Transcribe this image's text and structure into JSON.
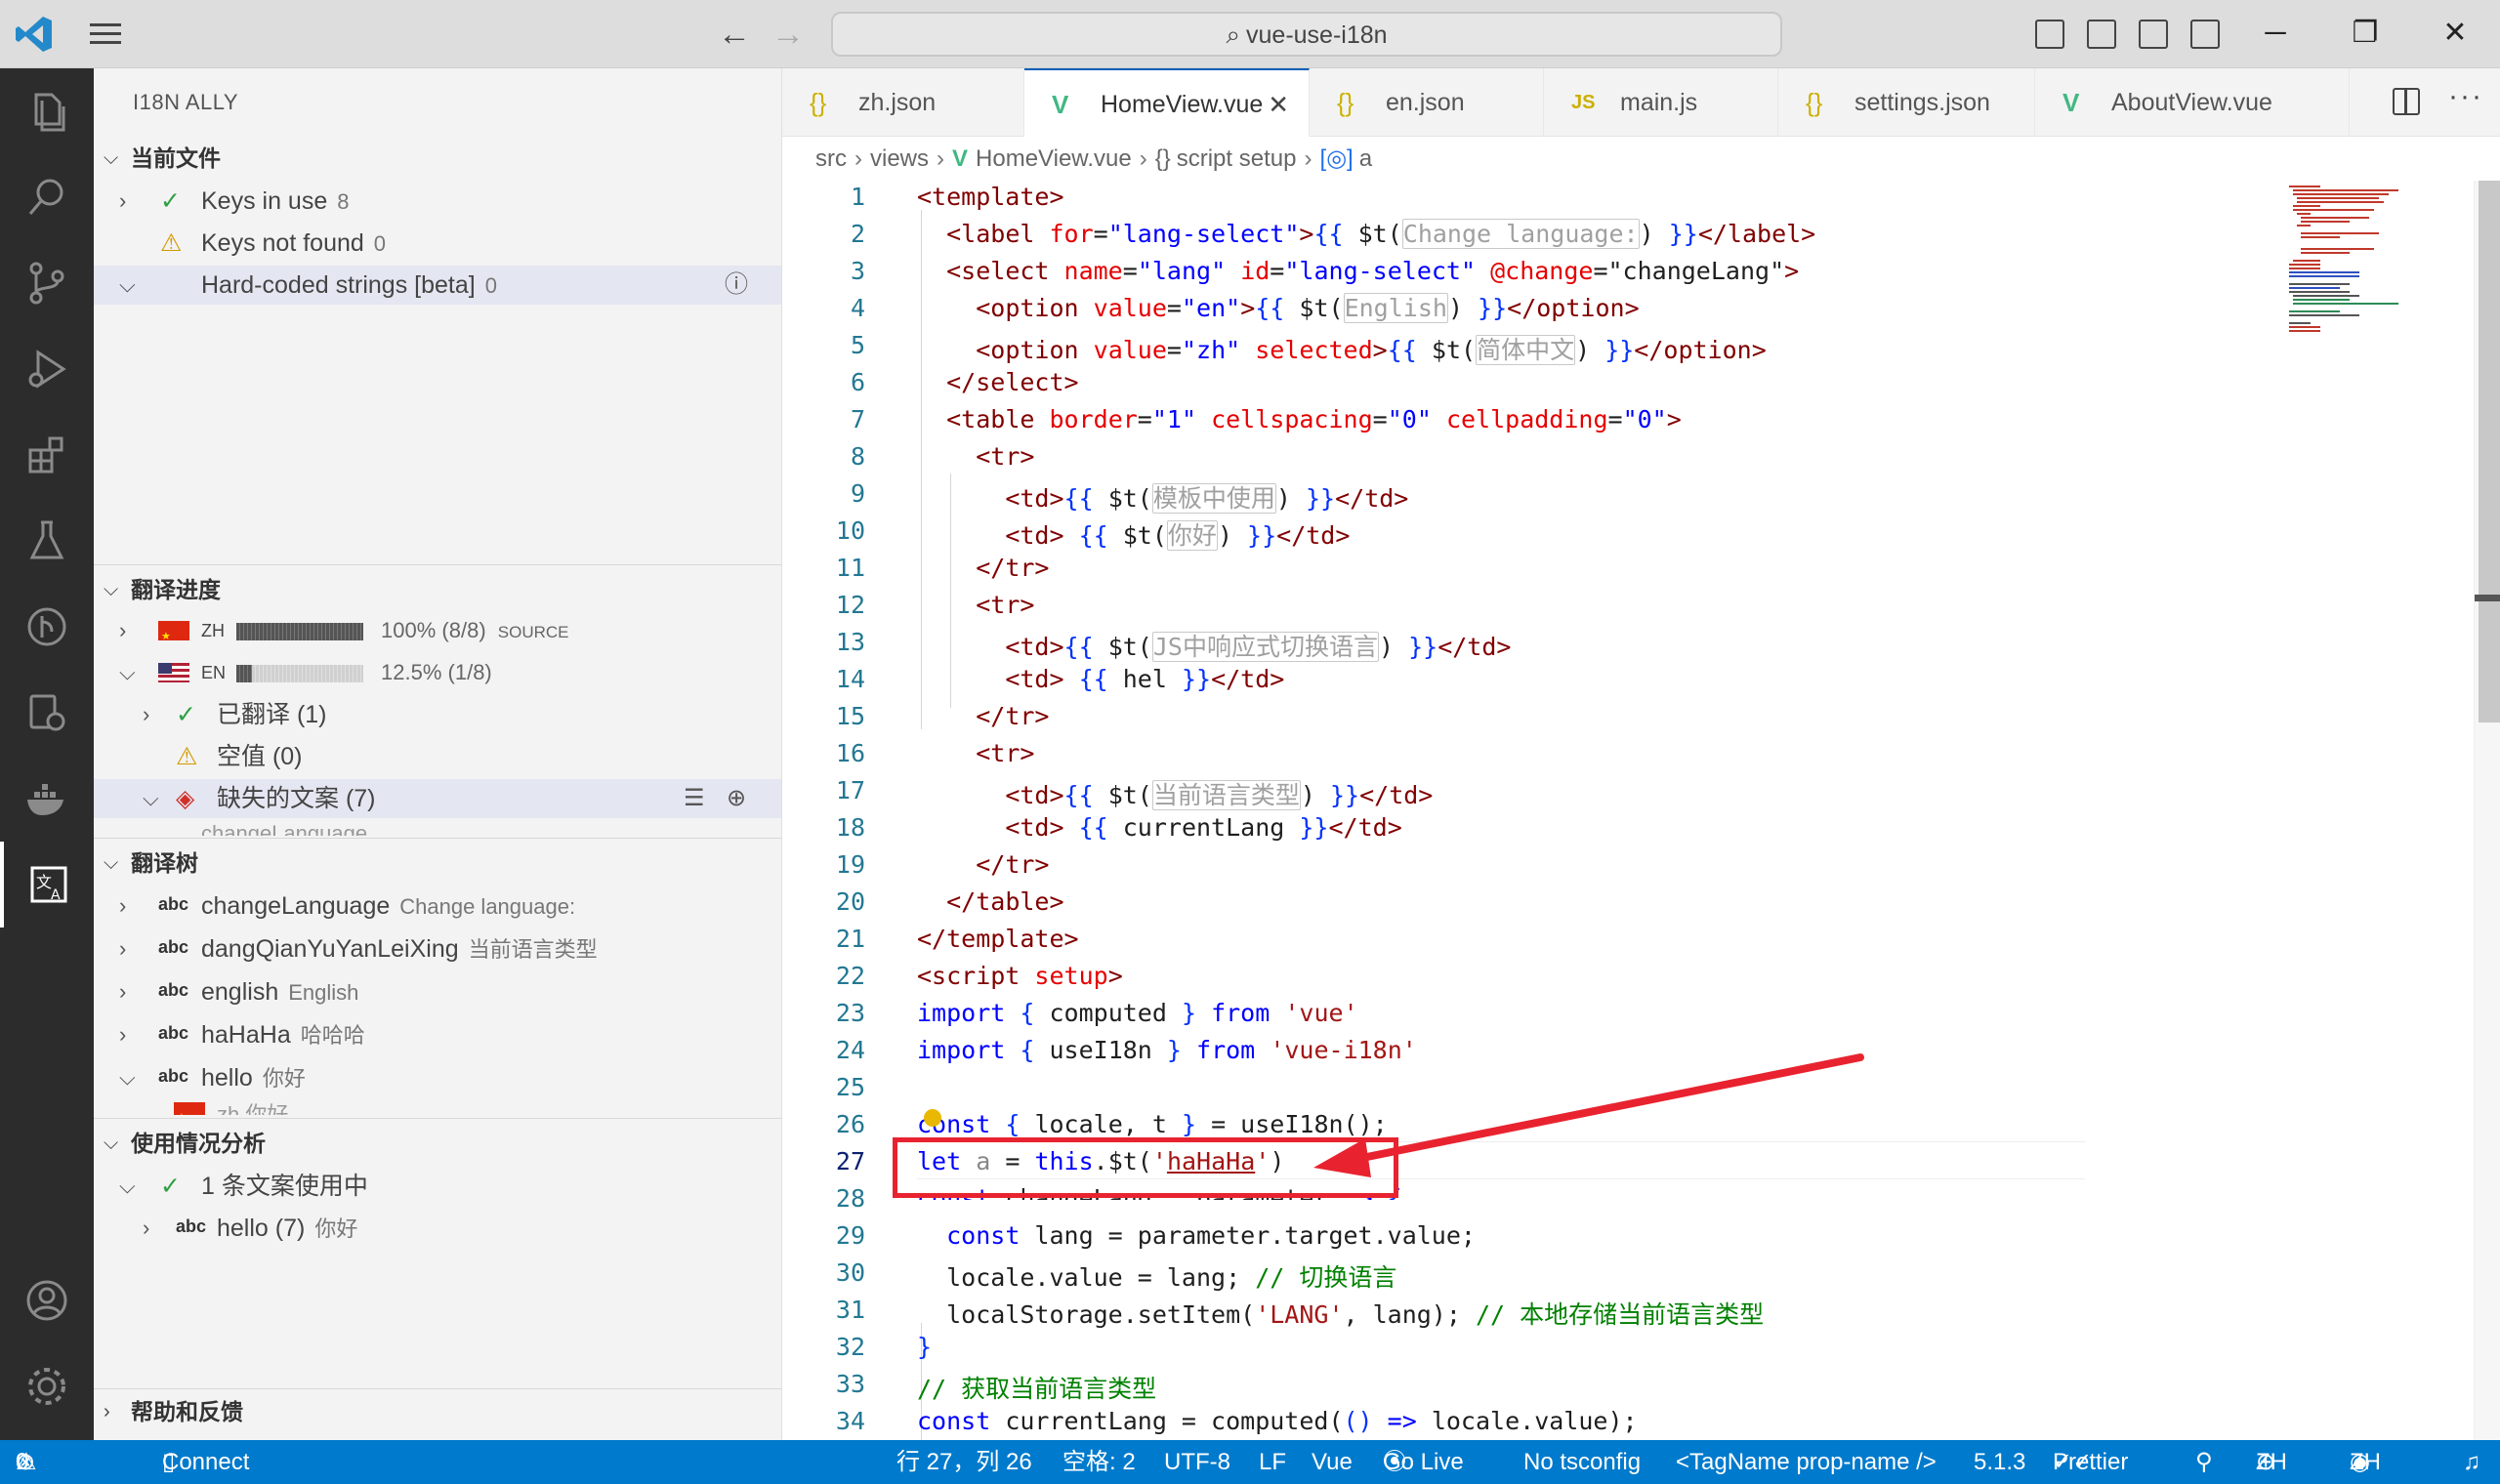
{
  "window": {
    "search_text": "vue-use-i18n"
  },
  "sidebar": {
    "title": "I18N ALLY",
    "current_file": {
      "header": "当前文件",
      "keys_in_use_label": "Keys in use",
      "keys_in_use_count": "8",
      "keys_not_found_label": "Keys not found",
      "keys_not_found_count": "0",
      "hardcoded_label": "Hard-coded strings [beta]",
      "hardcoded_count": "0"
    },
    "progress": {
      "header": "翻译进度",
      "zh": {
        "code": "ZH",
        "percent": "100%",
        "ratio": "(8/8)",
        "tag": "SOURCE",
        "fraction": 1.0
      },
      "en": {
        "code": "EN",
        "percent": "12.5%",
        "ratio": "(1/8)",
        "fraction": 0.125
      },
      "translated": "已翻译 (1)",
      "empty": "空值 (0)",
      "missing": "缺失的文案 (7)",
      "partial_item": "changeLanguage"
    },
    "tree": {
      "header": "翻译树",
      "items": [
        {
          "key": "changeLanguage",
          "value": "Change language:"
        },
        {
          "key": "dangQianYuYanLeiXing",
          "value": "当前语言类型"
        },
        {
          "key": "english",
          "value": "English"
        },
        {
          "key": "haHaHa",
          "value": "哈哈哈"
        },
        {
          "key": "hello",
          "value": "你好"
        }
      ],
      "partial_child": "zh 你好"
    },
    "usage": {
      "header": "使用情况分析",
      "in_use": "1 条文案使用中",
      "hello_item": "hello (7)",
      "hello_value": "你好"
    },
    "help": {
      "header": "帮助和反馈"
    }
  },
  "tabs": [
    {
      "label": "zh.json",
      "icon": "json-icon"
    },
    {
      "label": "HomeView.vue",
      "icon": "vue-icon",
      "active": true
    },
    {
      "label": "en.json",
      "icon": "json-icon"
    },
    {
      "label": "main.js",
      "icon": "js-icon"
    },
    {
      "label": "settings.json",
      "icon": "json-icon"
    },
    {
      "label": "AboutView.vue",
      "icon": "vue-icon"
    }
  ],
  "breadcrumb": {
    "src": "src",
    "views": "views",
    "file": "HomeView.vue",
    "setup": "script setup",
    "symbol": "a"
  },
  "editor": {
    "line_numbers": [
      "1",
      "2",
      "3",
      "4",
      "5",
      "6",
      "7",
      "8",
      "9",
      "10",
      "11",
      "12",
      "13",
      "14",
      "15",
      "16",
      "17",
      "18",
      "19",
      "20",
      "21",
      "22",
      "23",
      "24",
      "25",
      "26",
      "27",
      "28",
      "29",
      "30",
      "31",
      "32",
      "33",
      "34"
    ]
  },
  "statusbar": {
    "errors": "0",
    "warnings": "0",
    "connect": "Connect",
    "position": "行 27，列 26",
    "spaces": "空格: 2",
    "encoding": "UTF-8",
    "eol": "LF",
    "language": "Vue",
    "golive": "Go Live",
    "tsconfig": "No tsconfig",
    "tagname": "<TagName prop-name />",
    "version": "5.1.3",
    "prettier": "Prettier",
    "locale1": "ZH",
    "locale2": "ZH"
  },
  "colors": {
    "activity_bar": "#2c2c2c",
    "status_bar": "#007acc",
    "annotation_red": "#e8232f"
  }
}
